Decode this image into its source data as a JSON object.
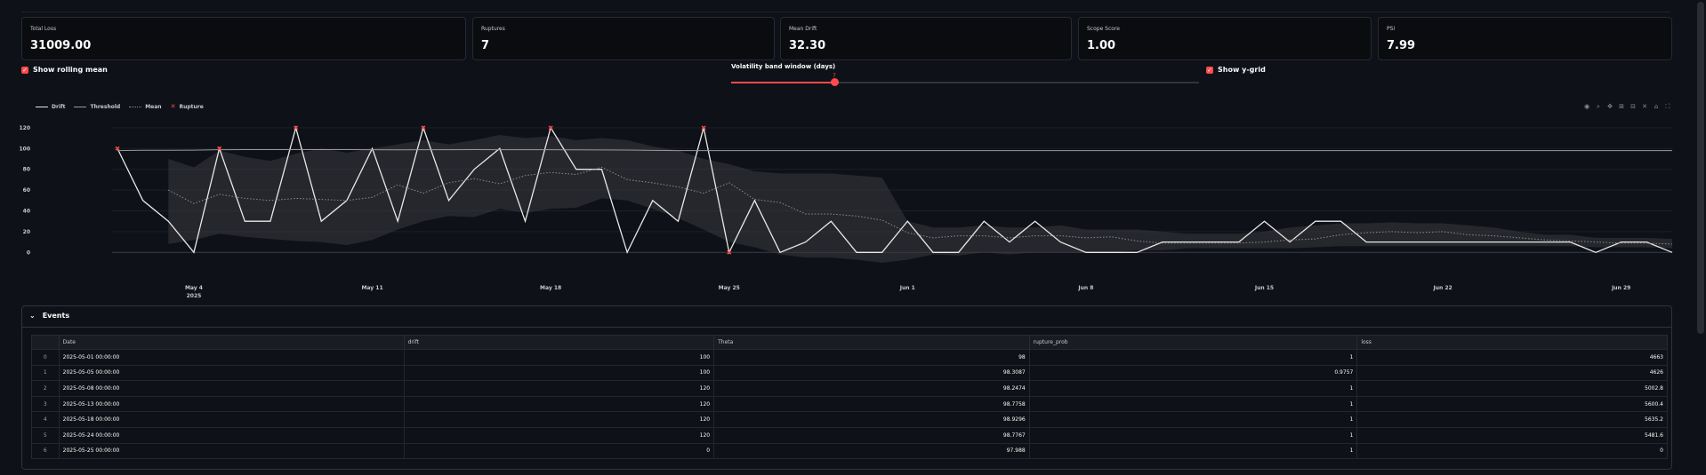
{
  "metrics": [
    {
      "label": "Total Loss",
      "value": "31009.00"
    },
    {
      "label": "Ruptures",
      "value": "7"
    },
    {
      "label": "Mean Drift",
      "value": "32.30"
    },
    {
      "label": "Scope Score",
      "value": "1.00"
    },
    {
      "label": "PSI",
      "value": "7.99"
    }
  ],
  "controls": {
    "rolling_label": "Show rolling mean",
    "rolling_checked": true,
    "slider_label": "Volatility band window (days)",
    "slider_value": "7",
    "slider_fraction": 0.22,
    "ygrid_label": "Show y-grid",
    "ygrid_checked": true
  },
  "legend": [
    "Drift",
    "Threshold",
    "Mean",
    "Rupture"
  ],
  "toolbar_icons": [
    "camera-icon",
    "zoom-icon",
    "pan-icon",
    "zoom-in-icon",
    "zoom-out-icon",
    "autoscale-icon",
    "home-icon",
    "fullscreen-icon"
  ],
  "chart_data": {
    "type": "line",
    "x_start": "2025-05-01",
    "x_ticks": [
      {
        "date": "2025-05-04",
        "label": "May 4",
        "sub": "2025"
      },
      {
        "date": "2025-05-11",
        "label": "May 11",
        "sub": ""
      },
      {
        "date": "2025-05-18",
        "label": "May 18",
        "sub": ""
      },
      {
        "date": "2025-05-25",
        "label": "May 25",
        "sub": ""
      },
      {
        "date": "2025-06-01",
        "label": "Jun 1",
        "sub": ""
      },
      {
        "date": "2025-06-08",
        "label": "Jun 8",
        "sub": ""
      },
      {
        "date": "2025-06-15",
        "label": "Jun 15",
        "sub": ""
      },
      {
        "date": "2025-06-22",
        "label": "Jun 22",
        "sub": ""
      },
      {
        "date": "2025-06-29",
        "label": "Jun 29",
        "sub": ""
      }
    ],
    "y_ticks": [
      0,
      20,
      40,
      60,
      80,
      100,
      120
    ],
    "ylim": [
      -10,
      125
    ],
    "series": [
      {
        "name": "Drift",
        "color": "#e8e8e8",
        "values": [
          100,
          50,
          30,
          0,
          100,
          30,
          30,
          120,
          30,
          50,
          100,
          30,
          120,
          50,
          80,
          100,
          30,
          120,
          80,
          80,
          0,
          50,
          30,
          120,
          0,
          50,
          0,
          10,
          30,
          0,
          0,
          30,
          0,
          0,
          30,
          10,
          30,
          10,
          0,
          0,
          0,
          10,
          10,
          10,
          10,
          30,
          10,
          30,
          30,
          10,
          10,
          10,
          10,
          10,
          10,
          10,
          10,
          10,
          0,
          10,
          10,
          0
        ]
      },
      {
        "name": "Threshold",
        "color": "#9a9a9a",
        "values": [
          98,
          98.3,
          98.25,
          98.45,
          98.78,
          98.9,
          98.93,
          98.95,
          98.95,
          98.9,
          98.8,
          98.7,
          98.78,
          98.8,
          98.9,
          98.85,
          98.8,
          98.78,
          98.7,
          98.6,
          98.5,
          98.2,
          98.0,
          97.99,
          97.99,
          98,
          98,
          98,
          98,
          98,
          98,
          98,
          98,
          98,
          98,
          98,
          98,
          98,
          98,
          98,
          98,
          98,
          98,
          98,
          98,
          98,
          98,
          98,
          98,
          98,
          98,
          98,
          98,
          98,
          98,
          98,
          98,
          98,
          98,
          98,
          98,
          98
        ]
      },
      {
        "name": "Mean",
        "color": "#8c8c8c",
        "values": [
          null,
          null,
          60,
          47,
          56,
          52,
          50,
          52,
          51,
          50,
          53,
          65,
          57,
          67,
          71,
          66,
          74,
          77,
          75,
          82,
          70,
          67,
          63,
          57,
          67,
          51,
          48,
          37,
          37,
          35,
          31,
          19,
          14,
          16,
          16,
          14,
          16,
          16,
          14,
          15,
          11,
          9,
          9,
          9,
          9,
          10,
          12,
          13,
          17,
          19,
          20,
          19,
          20,
          17,
          16,
          14,
          12,
          11,
          10,
          9,
          9,
          8
        ]
      }
    ],
    "band_upper": [
      null,
      null,
      90,
      82,
      98,
      92,
      88,
      95,
      100,
      96,
      100,
      104,
      108,
      104,
      108,
      113,
      110,
      112,
      108,
      110,
      108,
      102,
      98,
      90,
      85,
      78,
      76,
      76,
      76,
      74,
      72,
      30,
      24,
      24,
      26,
      24,
      24,
      26,
      22,
      22,
      22,
      20,
      18,
      18,
      18,
      20,
      24,
      26,
      28,
      28,
      29,
      28,
      28,
      26,
      24,
      20,
      17,
      17,
      14,
      14,
      14,
      13
    ],
    "band_lower": [
      null,
      null,
      8,
      12,
      18,
      15,
      13,
      11,
      10,
      7,
      12,
      22,
      30,
      35,
      34,
      42,
      38,
      42,
      43,
      52,
      50,
      42,
      33,
      22,
      10,
      5,
      -2,
      -5,
      -5,
      -7,
      -10,
      -7,
      -2,
      -3,
      0,
      -2,
      0,
      0,
      0,
      0,
      2,
      2,
      4,
      4,
      4,
      4,
      4,
      5,
      6,
      6,
      6,
      6,
      6,
      6,
      6,
      6,
      6,
      6,
      5,
      5,
      5,
      4
    ],
    "ruptures": [
      0,
      4,
      7,
      12,
      17,
      23,
      24
    ]
  },
  "events": {
    "title": "Events",
    "columns": [
      "",
      "Date",
      "drift",
      "Theta",
      "rupture_prob",
      "loss"
    ],
    "rows": [
      [
        "0",
        "2025-05-01 00:00:00",
        "100",
        "98",
        "1",
        "4663"
      ],
      [
        "1",
        "2025-05-05 00:00:00",
        "100",
        "98.3087",
        "0.9757",
        "4626"
      ],
      [
        "2",
        "2025-05-08 00:00:00",
        "120",
        "98.2474",
        "1",
        "5002.8"
      ],
      [
        "3",
        "2025-05-13 00:00:00",
        "120",
        "98.7758",
        "1",
        "5600.4"
      ],
      [
        "4",
        "2025-05-18 00:00:00",
        "120",
        "98.9296",
        "1",
        "5635.2"
      ],
      [
        "5",
        "2025-05-24 00:00:00",
        "120",
        "98.7767",
        "1",
        "5481.6"
      ],
      [
        "6",
        "2025-05-25 00:00:00",
        "0",
        "97.988",
        "1",
        "0"
      ]
    ]
  }
}
